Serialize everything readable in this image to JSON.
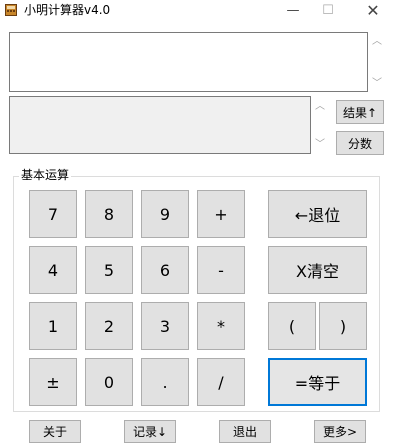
{
  "window": {
    "title": "小明计算器v4.0",
    "minimize": "—",
    "maximize": "☐",
    "close": "✕"
  },
  "display": {
    "input_value": "",
    "result_value": ""
  },
  "side_buttons": {
    "result": "结果↑",
    "fraction": "分数"
  },
  "scroll": {
    "up": "︿",
    "down": "﹀"
  },
  "basic_group": {
    "label": "基本运算",
    "keys": {
      "k7": "7",
      "k8": "8",
      "k9": "9",
      "plus": "+",
      "k4": "4",
      "k5": "5",
      "k6": "6",
      "minus": "-",
      "k1": "1",
      "k2": "2",
      "k3": "3",
      "multiply": "*",
      "negate": "±",
      "k0": "0",
      "dot": ".",
      "divide": "/",
      "backspace": "←退位",
      "clear": "X清空",
      "lparen": "(",
      "rparen": ")",
      "equals": "=等于"
    }
  },
  "bottom": {
    "about": "关于",
    "history": "记录↓",
    "exit": "退出",
    "more": "更多>"
  },
  "colors": {
    "button_face": "#e1e1e1",
    "focus_border": "#0078d7",
    "result_bg": "#f0f0f0"
  }
}
